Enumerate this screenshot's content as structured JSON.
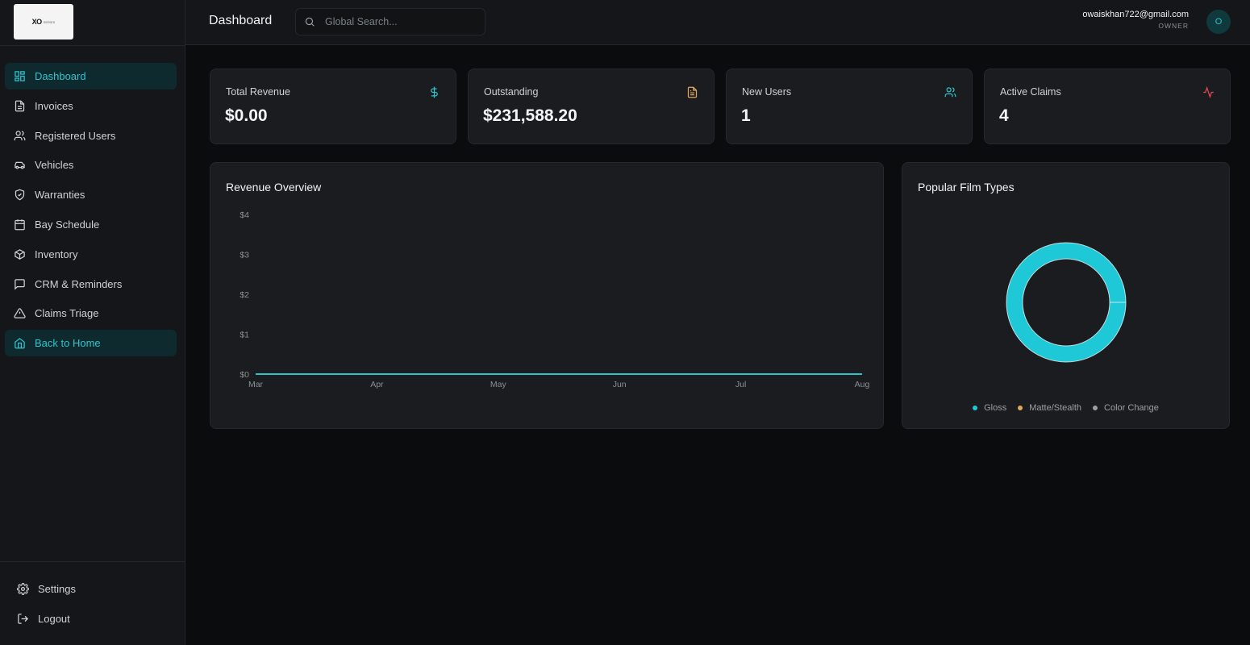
{
  "brand": {
    "logo_text": "XO",
    "logo_sub": "SERIES"
  },
  "sidebar": {
    "items": [
      {
        "label": "Dashboard",
        "icon": "grid-icon",
        "active": true
      },
      {
        "label": "Invoices",
        "icon": "file-icon"
      },
      {
        "label": "Registered Users",
        "icon": "users-icon"
      },
      {
        "label": "Vehicles",
        "icon": "car-icon"
      },
      {
        "label": "Warranties",
        "icon": "shield-icon"
      },
      {
        "label": "Bay Schedule",
        "icon": "calendar-icon"
      },
      {
        "label": "Inventory",
        "icon": "box-icon"
      },
      {
        "label": "CRM & Reminders",
        "icon": "message-icon"
      },
      {
        "label": "Claims Triage",
        "icon": "alert-triangle-icon"
      },
      {
        "label": "Back to Home",
        "icon": "home-icon",
        "active": true
      }
    ],
    "bottom": [
      {
        "label": "Settings",
        "icon": "gear-icon"
      },
      {
        "label": "Logout",
        "icon": "logout-icon"
      }
    ]
  },
  "header": {
    "title": "Dashboard",
    "search_placeholder": "Global Search...",
    "user_email": "owaiskhan722@gmail.com",
    "user_role": "OWNER",
    "avatar_initial": "O"
  },
  "stats": [
    {
      "label": "Total Revenue",
      "value": "$0.00",
      "icon": "dollar-icon",
      "color": "#2ec4cf"
    },
    {
      "label": "Outstanding",
      "value": "$231,588.20",
      "icon": "document-icon",
      "color": "#e0a85a"
    },
    {
      "label": "New Users",
      "value": "1",
      "icon": "users-icon",
      "color": "#2ec4cf"
    },
    {
      "label": "Active Claims",
      "value": "4",
      "icon": "activity-icon",
      "color": "#e5484d"
    }
  ],
  "revenue_panel": {
    "title": "Revenue Overview"
  },
  "film_panel": {
    "title": "Popular Film Types"
  },
  "chart_data": [
    {
      "type": "line",
      "title": "Revenue Overview",
      "categories": [
        "Mar",
        "Apr",
        "May",
        "Jun",
        "Jul",
        "Aug"
      ],
      "values": [
        0,
        0,
        0,
        0,
        0,
        0
      ],
      "yticks": [
        "$0",
        "$1",
        "$2",
        "$3",
        "$4"
      ],
      "ylim": [
        0,
        4
      ],
      "color": "#2ec4cf"
    },
    {
      "type": "pie",
      "title": "Popular Film Types",
      "categories": [
        "Gloss",
        "Matte/Stealth",
        "Color Change"
      ],
      "values": [
        1,
        0,
        0
      ],
      "colors": [
        "#1ec8d6",
        "#e0a85a",
        "#9aa0a5"
      ]
    }
  ]
}
